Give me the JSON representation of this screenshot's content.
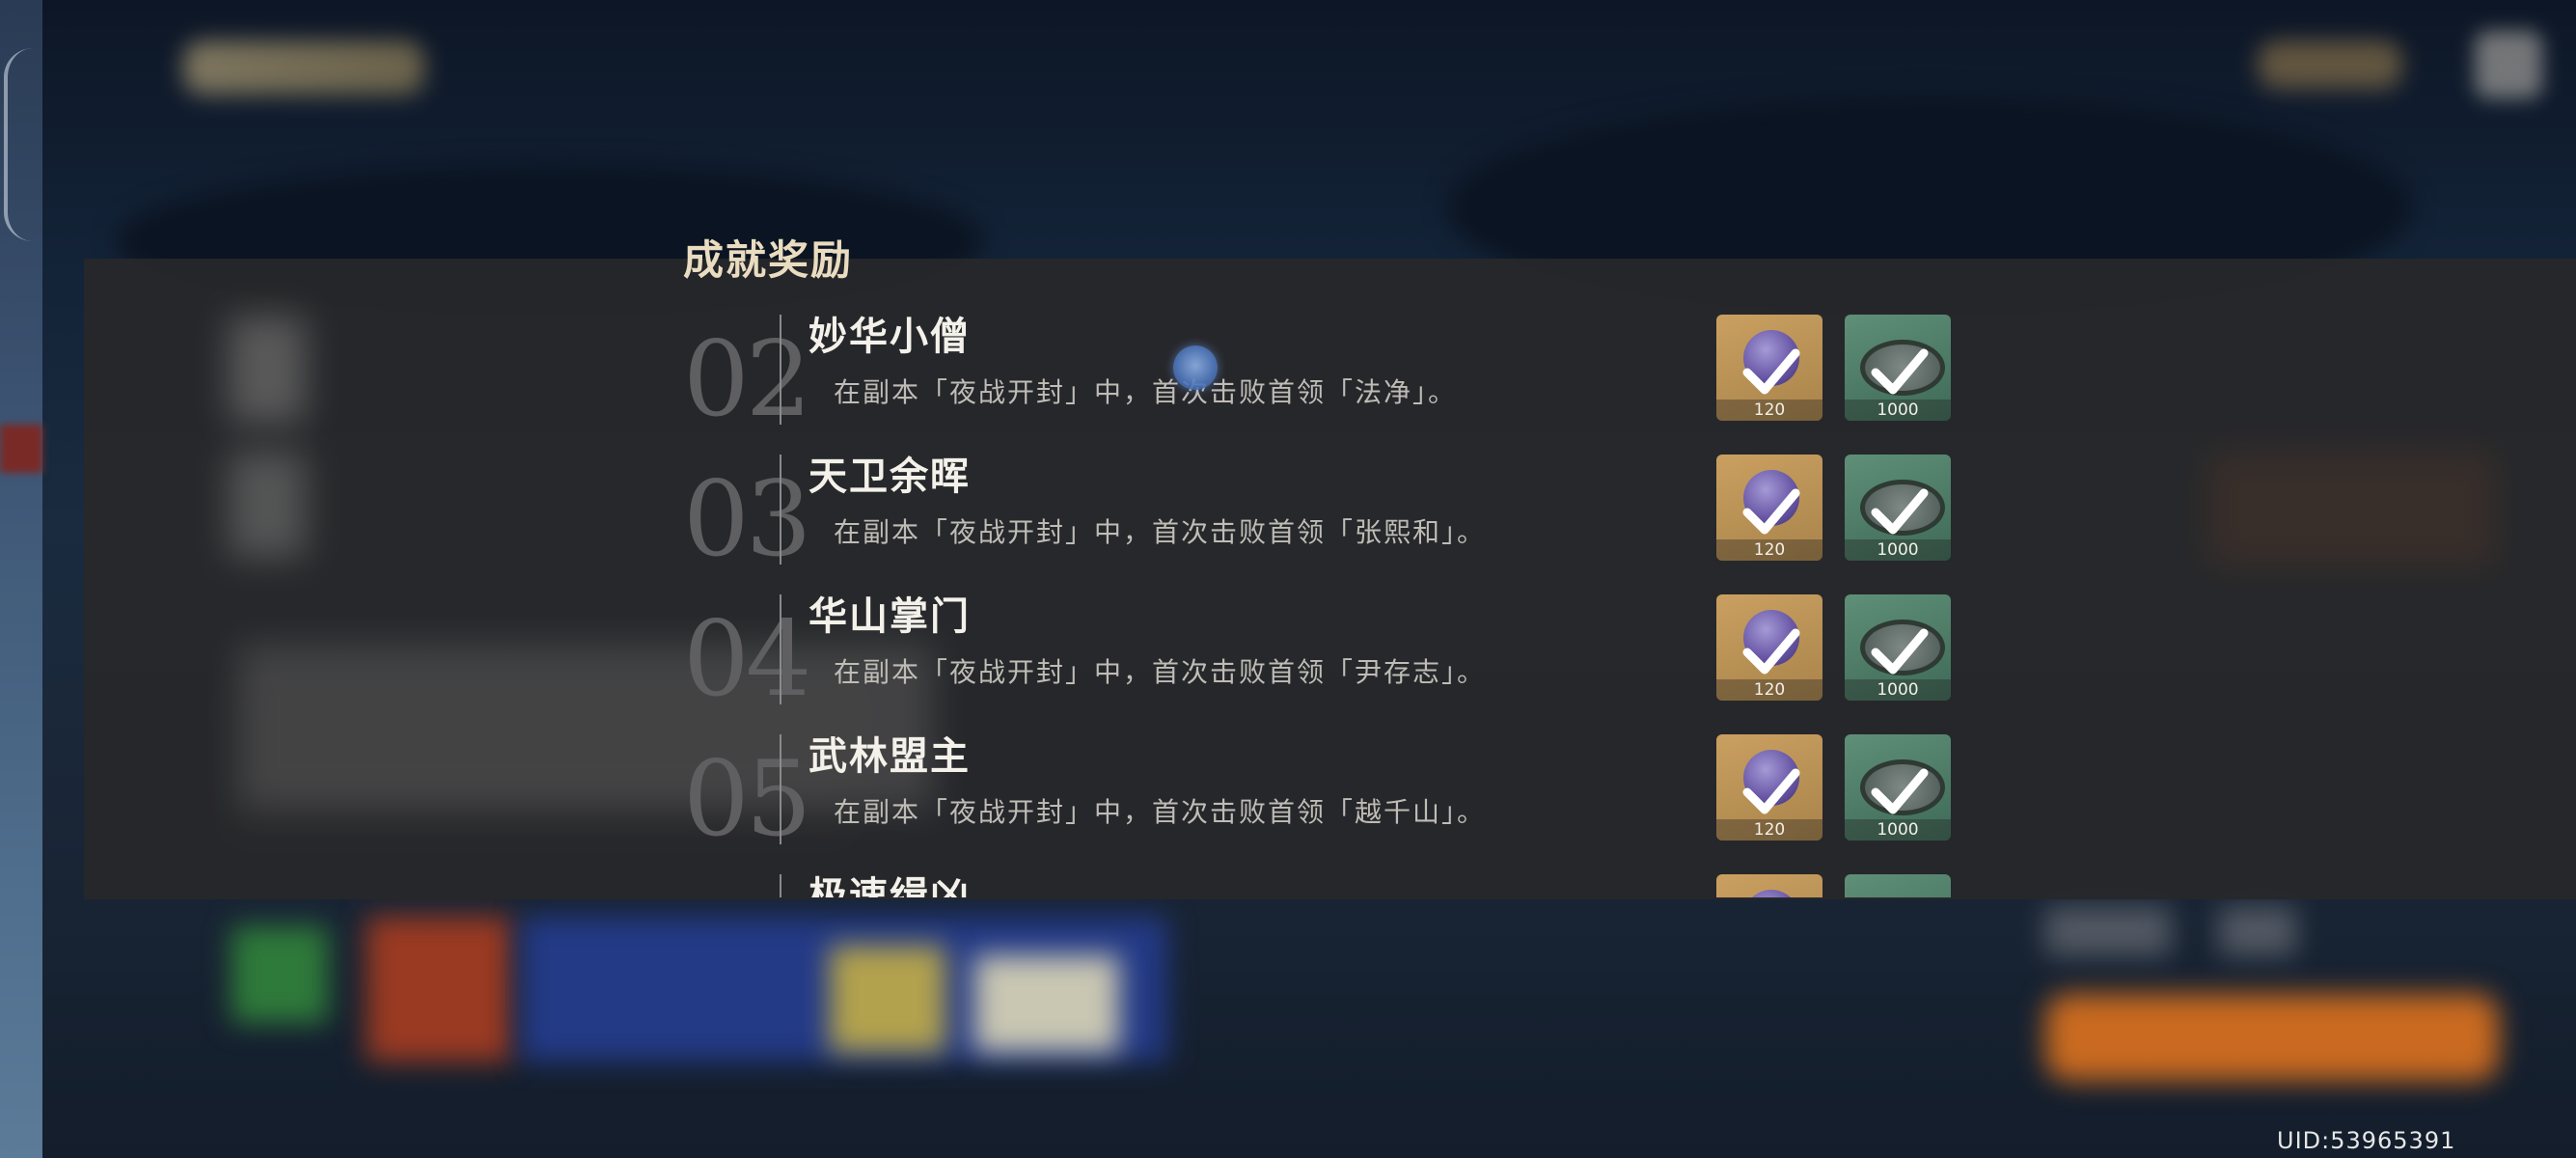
{
  "section_title": "成就奖励",
  "achievements": [
    {
      "num": "02",
      "name": "妙华小僧",
      "desc": "在副本「夜战开封」中，首次击败首领「法净」。",
      "rewards": [
        {
          "icon": "purple-orb-icon",
          "qty": "120"
        },
        {
          "icon": "silver-coil-icon",
          "qty": "1000"
        }
      ]
    },
    {
      "num": "03",
      "name": "天卫余晖",
      "desc": "在副本「夜战开封」中，首次击败首领「张熙和」。",
      "rewards": [
        {
          "icon": "purple-orb-icon",
          "qty": "120"
        },
        {
          "icon": "silver-coil-icon",
          "qty": "1000"
        }
      ]
    },
    {
      "num": "04",
      "name": "华山掌门",
      "desc": "在副本「夜战开封」中，首次击败首领「尹存志」。",
      "rewards": [
        {
          "icon": "purple-orb-icon",
          "qty": "120"
        },
        {
          "icon": "silver-coil-icon",
          "qty": "1000"
        }
      ]
    },
    {
      "num": "05",
      "name": "武林盟主",
      "desc": "在副本「夜战开封」中，首次击败首领「越千山」。",
      "rewards": [
        {
          "icon": "purple-orb-icon",
          "qty": "120"
        },
        {
          "icon": "silver-coil-icon",
          "qty": "1000"
        }
      ]
    },
    {
      "num": "",
      "name": "极速缉凶",
      "desc": "",
      "rewards": [
        {
          "icon": "purple-orb-icon",
          "qty": ""
        },
        {
          "icon": "silver-coil-icon",
          "qty": ""
        }
      ]
    }
  ],
  "uid": "UID:53965391",
  "colors": {
    "panel": "#28282a",
    "title": "#e9dcc0",
    "reward_gold": "#caa061",
    "reward_green": "#5f8f78"
  }
}
